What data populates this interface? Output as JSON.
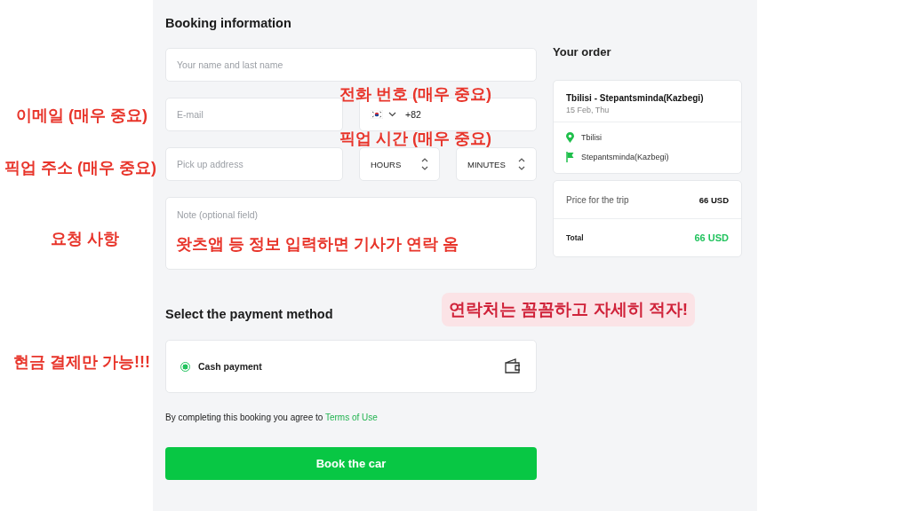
{
  "booking": {
    "title": "Booking information",
    "name": {
      "placeholder": "Your name and last name"
    },
    "email": {
      "placeholder": "E-mail"
    },
    "phone": {
      "value": "+82"
    },
    "pickup": {
      "placeholder": "Pick up address"
    },
    "hours": {
      "label": "HOURS"
    },
    "minutes": {
      "label": "MINUTES"
    },
    "note": {
      "placeholder": "Note (optional field)"
    }
  },
  "payment": {
    "title": "Select the payment method",
    "options": [
      {
        "label": "Cash payment",
        "selected": true
      }
    ],
    "terms": {
      "text": "By completing this booking you agree to",
      "link": "Terms of Use"
    },
    "button": "Book the car"
  },
  "order": {
    "title": "Your order",
    "route": "Tbilisi - Stepantsminda(Kazbegi)",
    "date": "15 Feb, Thu",
    "stops": [
      {
        "kind": "start",
        "name": "Tbilisi"
      },
      {
        "kind": "end",
        "name": "Stepantsminda(Kazbegi)"
      }
    ],
    "price": {
      "label": "Price for the trip",
      "value": "66 USD"
    },
    "total": {
      "label": "Total",
      "value": "66 USD"
    }
  },
  "annotations": [
    {
      "kind": "label",
      "text": "이메일 (매우 중요)"
    },
    {
      "kind": "label",
      "text": "전화 번호 (매우 중요)"
    },
    {
      "kind": "label",
      "text": "픽업 시간 (매우 중요)"
    },
    {
      "kind": "label",
      "text": "픽업 주소 (매우 중요)"
    },
    {
      "kind": "label",
      "text": "요청 사항"
    },
    {
      "kind": "label",
      "text": "왓츠앱 등 정보 입력하면 기사가 연락 옴"
    },
    {
      "kind": "callout",
      "text": "연락처는 꼼꼼하고 자세히 적자!"
    },
    {
      "kind": "label",
      "text": "현금 결제만 가능!!!"
    }
  ]
}
